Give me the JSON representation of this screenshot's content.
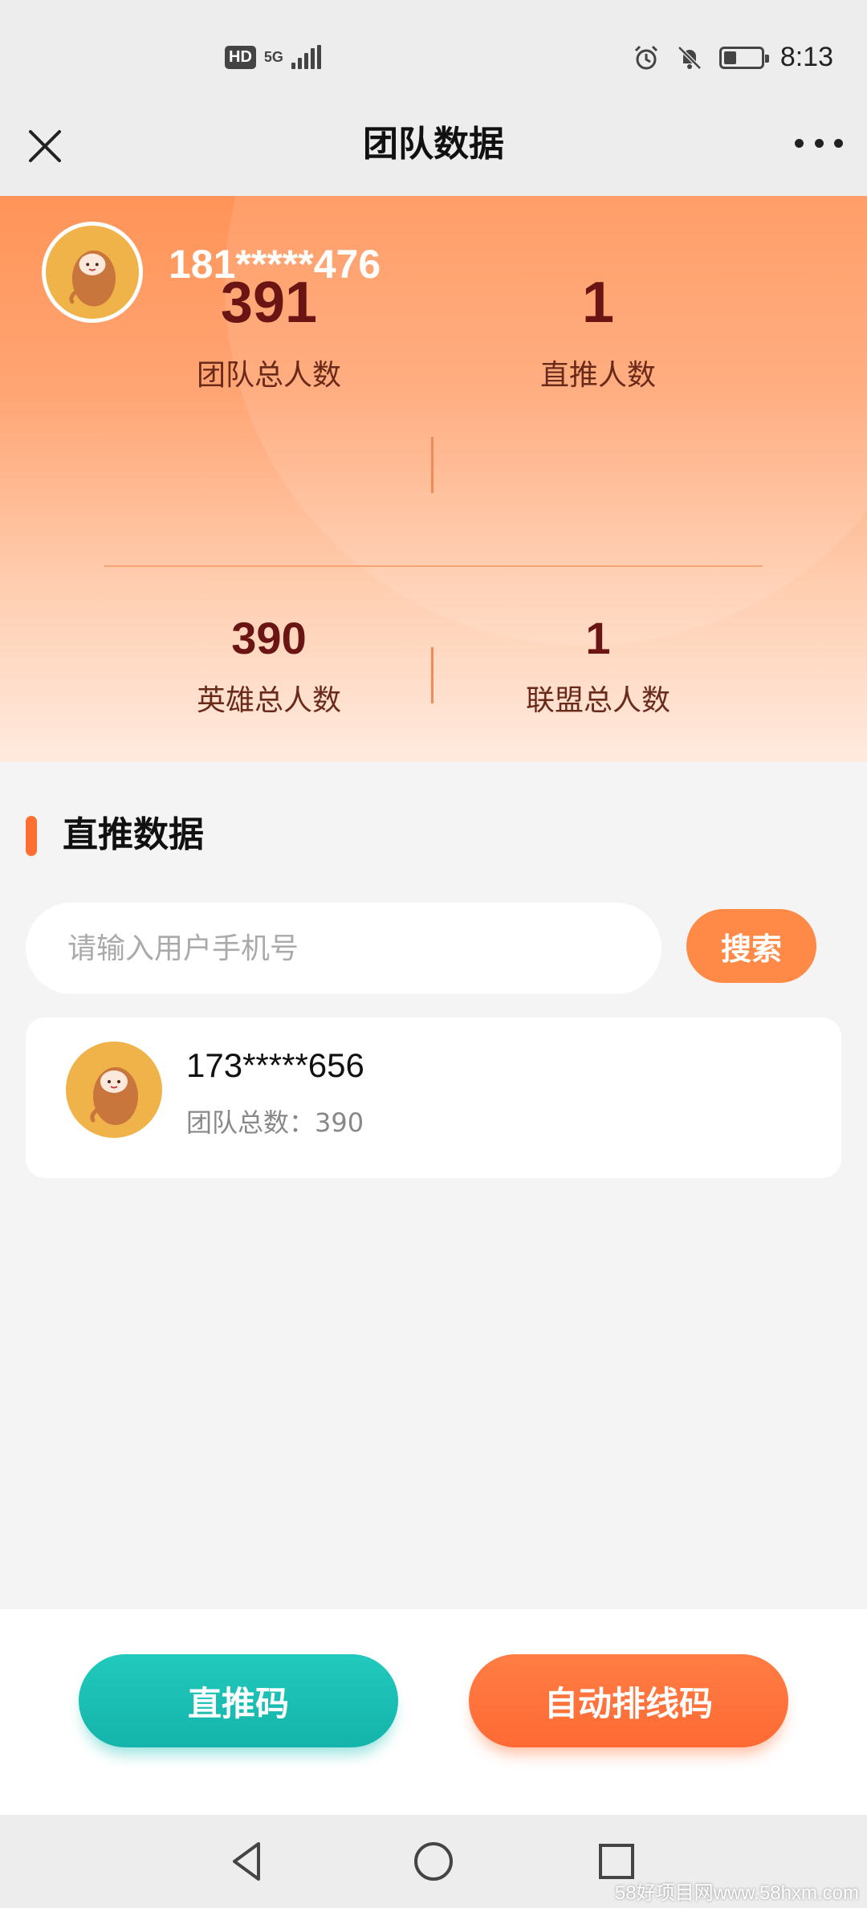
{
  "status_bar": {
    "hd_label": "HD",
    "network_label": "5G",
    "time": "8:13",
    "icons": [
      "signal-icon",
      "alarm-icon",
      "mute-icon",
      "battery-icon"
    ],
    "battery_level": 0.35
  },
  "nav": {
    "title": "团队数据",
    "close_icon": "close-icon",
    "more_icon": "more-icon"
  },
  "header": {
    "phone": "181*****476",
    "stats": {
      "team_total": {
        "value": "391",
        "label": "团队总人数"
      },
      "direct_count": {
        "value": "1",
        "label": "直推人数"
      },
      "hero_total": {
        "value": "390",
        "label": "英雄总人数"
      },
      "alliance_total": {
        "value": "1",
        "label": "联盟总人数"
      }
    }
  },
  "direct_section": {
    "title": "直推数据",
    "search_placeholder": "请输入用户手机号",
    "search_value": "",
    "search_button": "搜索",
    "members": [
      {
        "phone": "173*****656",
        "team_label": "团队总数：390"
      }
    ]
  },
  "bottom": {
    "direct_code_label": "直推码",
    "auto_code_label": "自动排线码"
  },
  "system_nav": {
    "icons": [
      "back-icon",
      "home-icon",
      "recents-icon"
    ]
  },
  "watermark": "58好项目网www.58hxm.com",
  "colors": {
    "accent_orange": "#ff8a48",
    "accent_teal": "#14b4aa",
    "stat_text": "#6a1414"
  }
}
